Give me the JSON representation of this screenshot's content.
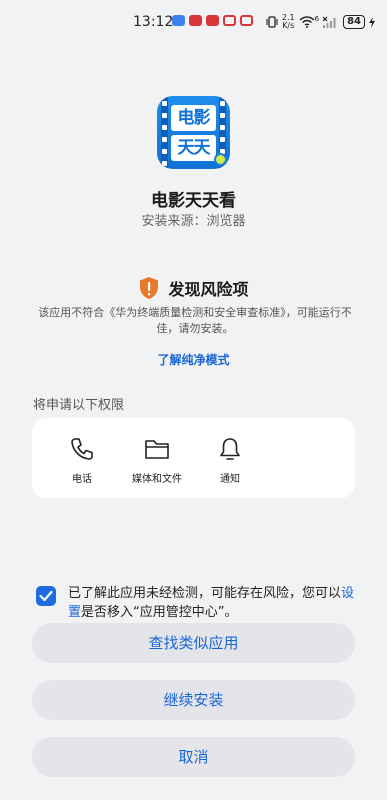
{
  "status_bar": {
    "time": "13:12",
    "network_speed_value": "2.1",
    "network_speed_unit": "K/s",
    "wifi_badge": "6",
    "battery": "84"
  },
  "app": {
    "icon_line1": "电影",
    "icon_line2": "天天",
    "name": "电影天天看",
    "source": "安装来源：浏览器"
  },
  "risk": {
    "title": "发现风险项",
    "description": "该应用不符合《华为终端质量检测和安全审查标准》，可能运行不佳，请勿安装。",
    "learn_more": "了解纯净模式",
    "accent_color": "#e8792b"
  },
  "permissions": {
    "heading": "将申请以下权限",
    "items": [
      {
        "label": "电话",
        "icon": "phone-icon"
      },
      {
        "label": "媒体和文件",
        "icon": "folder-icon"
      },
      {
        "label": "通知",
        "icon": "bell-icon"
      }
    ]
  },
  "consent": {
    "text_before": "已了解此应用未经检测，可能存在风险，您可以",
    "link": "设置",
    "text_after": "是否移入“应用管控中心”。",
    "checked": true
  },
  "buttons": {
    "find_similar": "查找类似应用",
    "continue_install": "继续安装",
    "cancel": "取消"
  },
  "colors": {
    "accent_blue": "#1a66d9",
    "button_bg": "#e4e5e8",
    "page_bg": "#f1f2f4"
  }
}
